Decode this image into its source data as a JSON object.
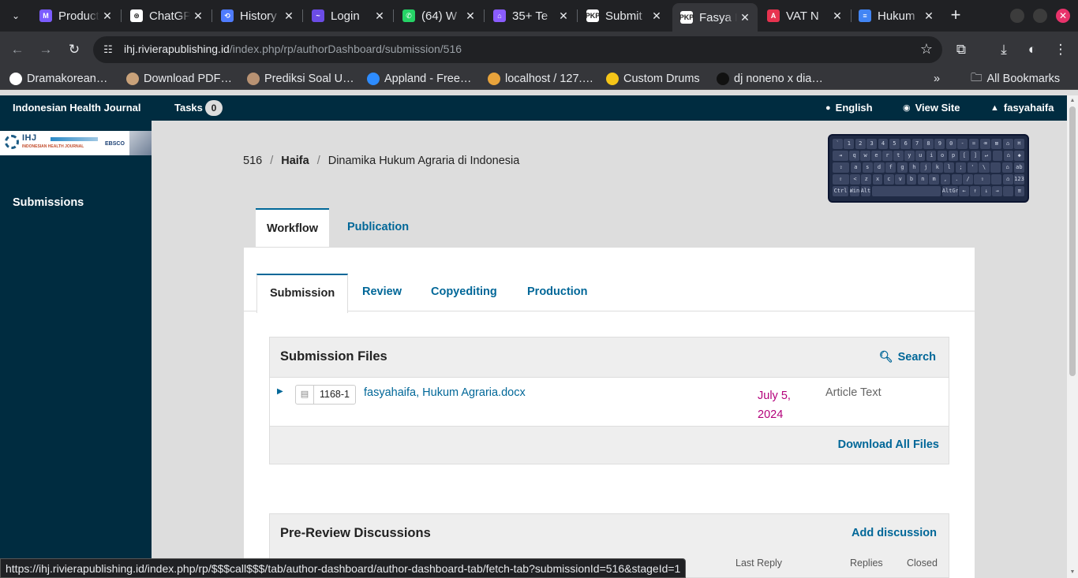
{
  "browser": {
    "tabs": [
      {
        "title": "Product",
        "favicon_color": "#7b5cff",
        "favicon_glyph": "M"
      },
      {
        "title": "ChatGPT",
        "favicon_color": "#ffffff",
        "favicon_glyph": "⊛"
      },
      {
        "title": "History",
        "favicon_color": "#4f7cff",
        "favicon_glyph": "⟲"
      },
      {
        "title": "Login",
        "favicon_color": "#6b4ce6",
        "favicon_glyph": "~"
      },
      {
        "title": "(64) W",
        "favicon_color": "#25d366",
        "favicon_glyph": "✆"
      },
      {
        "title": "35+ Te",
        "favicon_color": "#8a5cff",
        "favicon_glyph": "⌂"
      },
      {
        "title": "Submit",
        "favicon_color": "#ffffff",
        "favicon_glyph": "PKP"
      },
      {
        "title": "Fasya H",
        "favicon_color": "#ffffff",
        "favicon_glyph": "PKP",
        "active": true
      },
      {
        "title": "VAT N",
        "favicon_color": "#e7334f",
        "favicon_glyph": "A"
      },
      {
        "title": "Hukum",
        "favicon_color": "#4285f4",
        "favicon_glyph": "≡"
      }
    ],
    "url_host": "ihj.rivierapublishing.id",
    "url_path": "/index.php/rp/authorDashboard/submission/516",
    "bookmarks": [
      {
        "label": "Dramakorean…",
        "color": "#ffffff"
      },
      {
        "label": "Download PDF…",
        "color": "#c9a27a"
      },
      {
        "label": "Prediksi Soal U…",
        "color": "#b89273"
      },
      {
        "label": "Appland - Free…",
        "color": "#2d8cff"
      },
      {
        "label": "localhost / 127.…",
        "color": "#e8a33b"
      },
      {
        "label": "Custom Drums",
        "color": "#f5c518"
      },
      {
        "label": "dj noneno x dia…",
        "color": "#111111"
      }
    ],
    "all_bookmarks": "All Bookmarks",
    "status_url": "https://ihj.rivierapublishing.id/index.php/rp/$$$call$$$/tab/author-dashboard/author-dashboard-tab/fetch-tab?submissionId=516&stageId=1"
  },
  "app": {
    "journal_name": "Indonesian Health Journal",
    "tasks_label": "Tasks",
    "tasks_count": "0",
    "language": "English",
    "view_site": "View Site",
    "username": "fasyahaifa"
  },
  "logo": {
    "ihj": "IHJ",
    "subtitle": "INDONESIAN HEALTH JOURNAL",
    "ebsco": "EBSCO"
  },
  "sidebar": {
    "submissions": "Submissions"
  },
  "breadcrumb": {
    "id": "516",
    "author": "Haifa",
    "title": "Dinamika Hukum Agraria di Indonesia"
  },
  "main_tabs": {
    "workflow": "Workflow",
    "publication": "Publication"
  },
  "stage_tabs": {
    "submission": "Submission",
    "review": "Review",
    "copyediting": "Copyediting",
    "production": "Production"
  },
  "submission_files": {
    "title": "Submission Files",
    "search": "Search",
    "files": [
      {
        "id": "1168-1",
        "name": "fasyahaifa, Hukum Agraria.docx",
        "date": "July 5, 2024",
        "type": "Article Text"
      }
    ],
    "download_all": "Download All Files"
  },
  "discussions": {
    "title": "Pre-Review Discussions",
    "add": "Add discussion",
    "columns": {
      "last_reply": "Last Reply",
      "replies": "Replies",
      "closed": "Closed"
    }
  },
  "keyboard": {
    "rows": [
      [
        "`",
        "1",
        "2",
        "3",
        "4",
        "5",
        "6",
        "7",
        "8",
        "9",
        "0",
        "-",
        "=",
        "⌫",
        "⊠",
        "⌂",
        "⌘"
      ],
      [
        "⇥",
        "q",
        "w",
        "e",
        "r",
        "t",
        "y",
        "u",
        "i",
        "o",
        "p",
        "[",
        "]",
        "↵",
        "",
        "⌂",
        "◆"
      ],
      [
        "⇪",
        "a",
        "s",
        "d",
        "f",
        "g",
        "h",
        "j",
        "k",
        "l",
        ";",
        "'",
        "\\",
        "",
        "⌂",
        "ab"
      ],
      [
        "⇧",
        "<",
        "z",
        "x",
        "c",
        "v",
        "b",
        "n",
        "m",
        ",",
        ".",
        "/",
        "⇧",
        "",
        "⌂",
        "123"
      ],
      [
        "Ctrl",
        "Win",
        "Alt",
        "",
        "AltGr",
        "←",
        "↑",
        "↓",
        "→",
        "",
        "≡"
      ]
    ]
  }
}
